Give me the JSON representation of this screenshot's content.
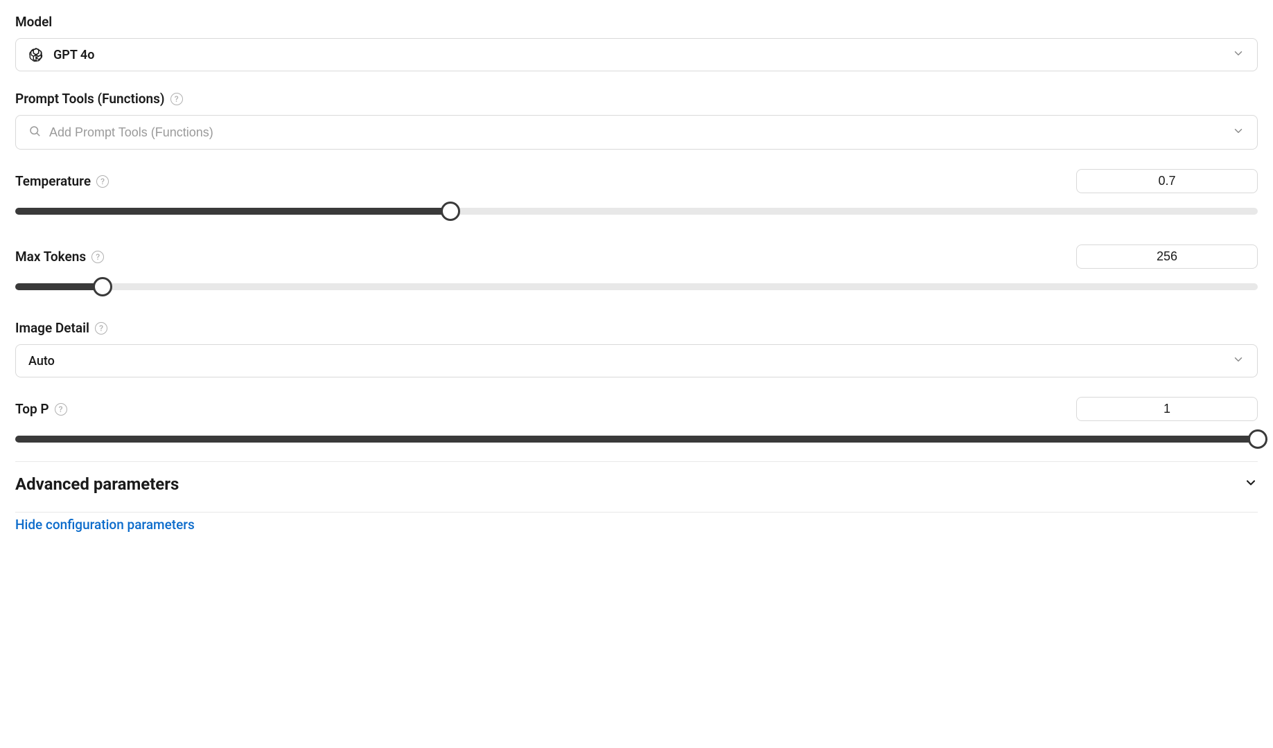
{
  "model": {
    "label": "Model",
    "selected": "GPT 4o"
  },
  "promptTools": {
    "label": "Prompt Tools (Functions)",
    "placeholder": "Add Prompt Tools (Functions)"
  },
  "temperature": {
    "label": "Temperature",
    "value": "0.7",
    "percent": 35
  },
  "maxTokens": {
    "label": "Max Tokens",
    "value": "256",
    "percent": 7
  },
  "imageDetail": {
    "label": "Image Detail",
    "selected": "Auto"
  },
  "topP": {
    "label": "Top P",
    "value": "1",
    "percent": 100
  },
  "advanced": {
    "title": "Advanced parameters"
  },
  "hideLink": "Hide configuration parameters"
}
